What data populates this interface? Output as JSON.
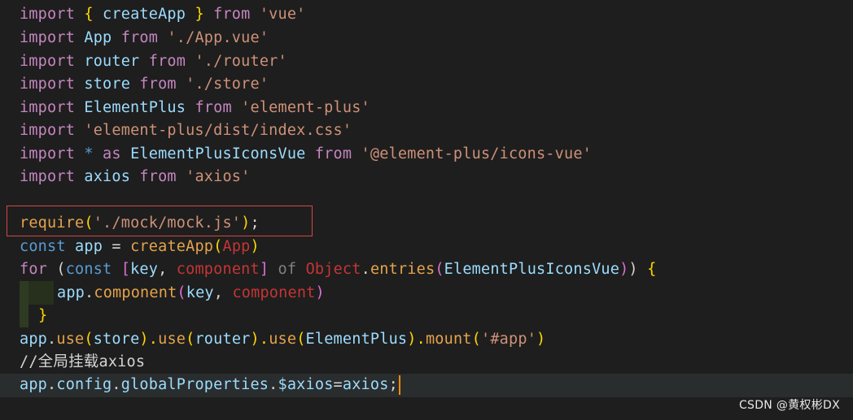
{
  "editor": {
    "lines": {
      "l1": {
        "a": "import",
        "b": " ",
        "c": "{",
        "d": " createApp ",
        "e": "}",
        "f": " from ",
        "g": "'vue'"
      },
      "l2": {
        "a": "import",
        "b": " App ",
        "c": "from",
        "d": " ",
        "e": "'./App.vue'"
      },
      "l3": {
        "a": "import",
        "b": " router ",
        "c": "from",
        "d": " ",
        "e": "'./router'"
      },
      "l4": {
        "a": "import",
        "b": " store ",
        "c": "from",
        "d": " ",
        "e": "'./store'"
      },
      "l5": {
        "a": "import",
        "b": " ElementPlus ",
        "c": "from",
        "d": " ",
        "e": "'element-plus'"
      },
      "l6": {
        "a": "import",
        "b": " ",
        "c": "'element-plus/dist/index.css'"
      },
      "l7": {
        "a": "import",
        "b": " * ",
        "c": "as",
        "d": " ElementPlusIconsVue ",
        "e": "from",
        "f": " ",
        "g": "'@element-plus/icons-vue'"
      },
      "l8": {
        "a": "import",
        "b": " axios ",
        "c": "from",
        "d": " ",
        "e": "'axios'"
      },
      "l10": {
        "a": "require",
        "b": "(",
        "c": "'./mock/mock.js'",
        "d": ")",
        "e": ";"
      },
      "l11": {
        "a": "const",
        "b": " app ",
        "c": "=",
        "d": " ",
        "e": "createApp",
        "f": "(",
        "g": "App",
        "h": ")"
      },
      "l12": {
        "a": "for",
        "b": " (",
        "c": "const",
        "d": " ",
        "e": "[",
        "f": "key",
        "g": ", ",
        "h": "component",
        "i": "]",
        "j": " ",
        "k": "of",
        "l": " ",
        "m": "Object",
        "n": ".",
        "o": "entries",
        "p": "(",
        "q": "ElementPlusIconsVue",
        "r": ")",
        "s": ")",
        " t": " ",
        "u": "{"
      },
      "l13": {
        "a": "app",
        "b": ".",
        "c": "component",
        "d": "(",
        "e": "key",
        "f": ", ",
        "g": "component",
        "h": ")"
      },
      "l14": {
        "a": "}"
      },
      "l15": {
        "a": "app",
        "b": ".",
        "c": "use",
        "d": "(",
        "e": "store",
        "f": ").",
        "g": "use",
        "h": "(",
        "i": "router",
        "j": ").",
        "k": "use",
        "l": "(",
        "m": "ElementPlus",
        "n": ").",
        "o": "mount",
        "p": "(",
        "q": "'#app'",
        "r": ")"
      },
      "l16": {
        "a": "//全局挂载axios"
      },
      "l17": {
        "a": "app",
        "b": ".",
        "c": "config",
        "d": ".",
        "e": "globalProperties",
        "f": ".",
        "g": "$axios",
        "h": "=",
        "i": "axios",
        "j": ";"
      }
    }
  },
  "watermark": "CSDN @黄权彬DX",
  "colors": {
    "background": "#1e1e1e",
    "highlight_box": "#d64545",
    "cursor": "#ff8c00"
  }
}
